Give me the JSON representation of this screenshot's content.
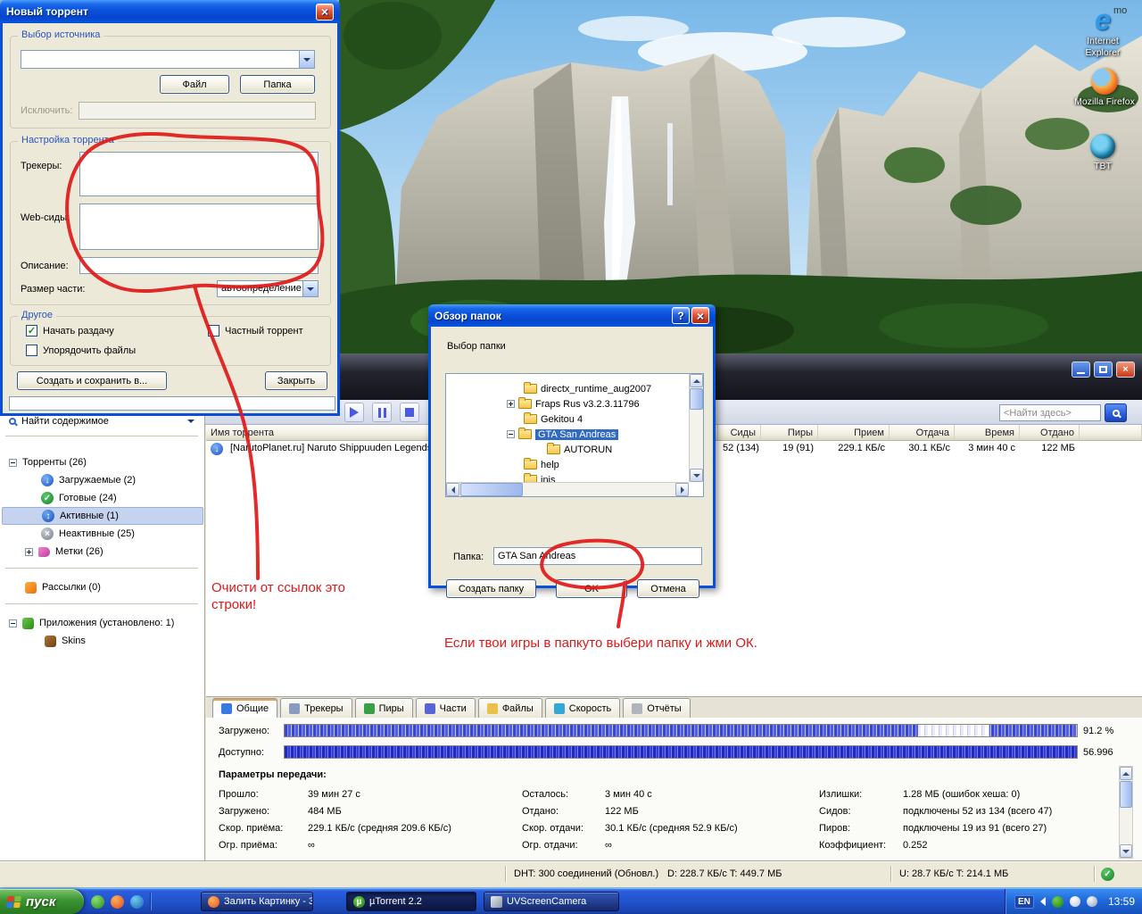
{
  "desktop": {
    "icons": {
      "ie_label": "Internet Explorer",
      "firefox_label": "Mozilla Firefox",
      "tbt_label": "TBT",
      "partial_label": "mo"
    }
  },
  "new_torrent": {
    "title": "Новый торрент",
    "source_group": "Выбор источника",
    "source_value": "",
    "file_button": "Файл",
    "folder_button": "Папка",
    "exclude_label": "Исключить:",
    "exclude_value": "",
    "settings_group": "Настройка торрента",
    "trackers_label": "Трекеры:",
    "trackers_value": "",
    "webseeds_label": "Web-сиды:",
    "webseeds_value": "",
    "description_label": "Описание:",
    "description_value": "",
    "piece_size_label": "Размер части:",
    "piece_size_value": "автоопределение",
    "other_group": "Другое",
    "start_seeding_checkbox": "Начать раздачу",
    "private_checkbox": "Частный торрент",
    "arrange_checkbox": "Упорядочить файлы",
    "create_button": "Создать и сохранить в...",
    "close_button": "Закрыть"
  },
  "browse": {
    "title": "Обзор папок",
    "prompt": "Выбор папки",
    "tree": [
      {
        "label": "directx_runtime_aug2007"
      },
      {
        "label": "Fraps Rus v3.2.3.11796"
      },
      {
        "label": "Gekitou 4"
      },
      {
        "label": "GTA San Andreas"
      },
      {
        "label": "AUTORUN"
      },
      {
        "label": "help"
      },
      {
        "label": "inis"
      }
    ],
    "folder_label": "Папка:",
    "folder_value": "GTA San Andreas",
    "create_folder_button": "Создать папку",
    "ok_button": "OK",
    "cancel_button": "Отмена"
  },
  "main": {
    "search_value": "<Найти здесь>",
    "sidebar": {
      "find_content": "Найти содержимое",
      "items": [
        "Торренты (26)",
        "Загружаемые (2)",
        "Готовые (24)",
        "Активные (1)",
        "Неактивные (25)",
        "Метки (26)",
        "Рассылки (0)",
        "Приложения (установлено: 1)",
        "Skins"
      ]
    },
    "columns": [
      "Имя торрента",
      "Сиды",
      "Пиры",
      "Прием",
      "Отдача",
      "Время",
      "Отдано"
    ],
    "row": {
      "name": "[NarutoPlanet.ru] Naruto Shippuuden Legends",
      "seeds": "52 (134)",
      "peers": "19 (91)",
      "down_speed": "229.1 КБ/с",
      "up_speed": "30.1 КБ/с",
      "time": "3 мин 40 с",
      "uploaded": "122 МБ"
    },
    "tabs": [
      "Общие",
      "Трекеры",
      "Пиры",
      "Части",
      "Файлы",
      "Скорость",
      "Отчёты"
    ],
    "general": {
      "downloaded_label": "Загружено:",
      "downloaded_value": "91.2 %",
      "available_label": "Доступно:",
      "available_value": "56.996",
      "transfer_header": "Параметры передачи:",
      "col1": [
        {
          "label": "Прошло:",
          "value": "39 мин 27 с"
        },
        {
          "label": "Загружено:",
          "value": "484 МБ"
        },
        {
          "label": "Скор. приёма:",
          "value": "229.1 КБ/с (средняя 209.6 КБ/с)"
        },
        {
          "label": "Огр. приёма:",
          "value": "∞"
        }
      ],
      "col2": [
        {
          "label": "Осталось:",
          "value": "3 мин 40 с"
        },
        {
          "label": "Отдано:",
          "value": "122 МБ"
        },
        {
          "label": "Скор. отдачи:",
          "value": "30.1 КБ/с (средняя 52.9 КБ/с)"
        },
        {
          "label": "Огр. отдачи:",
          "value": "∞"
        }
      ],
      "col3": [
        {
          "label": "Излишки:",
          "value": "1.28 МБ (ошибок хеша: 0)"
        },
        {
          "label": "Сидов:",
          "value": "подключены 52 из 134 (всего 47)"
        },
        {
          "label": "Пиров:",
          "value": "подключены 19 из 91 (всего 27)"
        },
        {
          "label": "Коэффициент:",
          "value": "0.252"
        }
      ]
    },
    "statusbar": {
      "dht": "DHT: 300 соединений (Обновл.)",
      "down_total": "D: 228.7 КБ/с T: 449.7 МБ",
      "up_total": "U: 28.7 КБ/с T: 214.1 МБ"
    }
  },
  "annotations": {
    "note1": "Очисти от ссылок это строки!",
    "note2": "Если твои игры в папкуто выбери папку и жми ОК."
  },
  "taskbar": {
    "start_button": "пуск",
    "tasks": [
      "Залить Картинку - 3...",
      "µTorrent 2.2",
      "UVScreenCamera"
    ],
    "language": "EN",
    "clock": "13:59"
  }
}
